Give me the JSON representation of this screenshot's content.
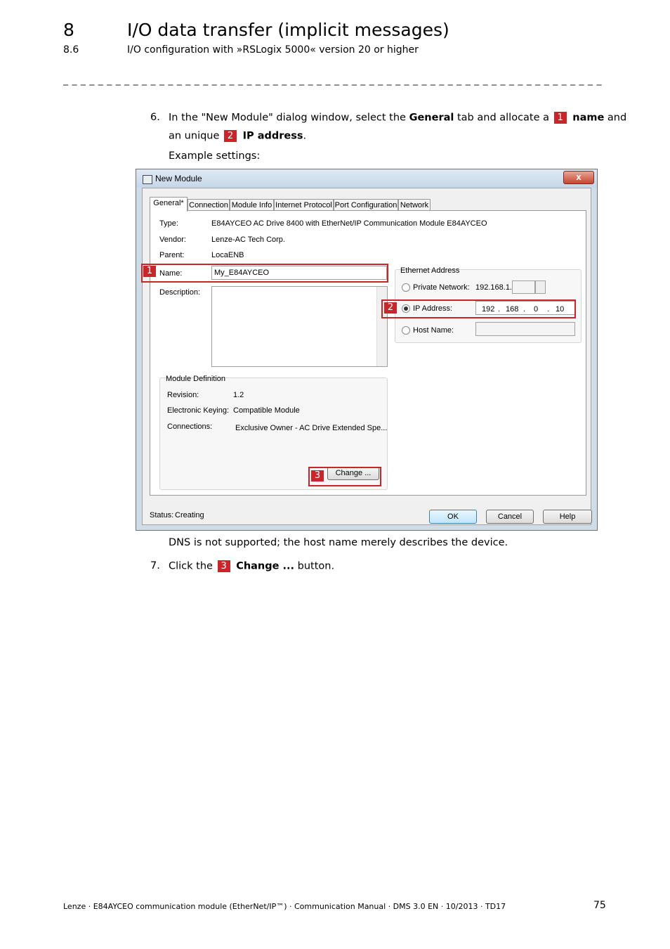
{
  "header": {
    "chapter_number": "8",
    "chapter_title": "I/O data transfer (implicit messages)",
    "section_number": "8.6",
    "section_title": "I/O configuration with »RSLogix 5000« version 20 or higher",
    "separator": "_ _ _ _ _ _ _ _ _ _ _ _ _ _ _ _ _ _ _ _ _ _ _ _ _ _ _ _ _ _ _ _ _ _ _ _ _ _ _ _ _ _ _ _ _ _ _ _ _ _ _ _ _ _ _ _ _ _ _ _ _ _ _ _ _"
  },
  "steps": {
    "step6": {
      "number": "6.",
      "line1_a": "In the \"New Module\" dialog window, select the ",
      "line1_bold": "General",
      "line1_b": " tab and allocate a ",
      "badge1": "1",
      "line1_name": "name",
      "line1_c": " and",
      "line2_a": "an unique ",
      "badge2": "2",
      "line2_bold": "IP address",
      "line2_b": ".",
      "example": "Example settings:"
    },
    "dns_note": "DNS is not supported; the host name merely describes the device.",
    "step7": {
      "number": "7.",
      "text_a": "Click the ",
      "badge3": "3",
      "text_bold": "Change ...",
      "text_b": " button."
    }
  },
  "dialog": {
    "title": "New Module",
    "close": "x",
    "tabs": [
      "General*",
      "Connection",
      "Module Info",
      "Internet Protocol",
      "Port Configuration",
      "Network"
    ],
    "type_label": "Type:",
    "type_value": "E84AYCEO AC Drive 8400 with EtherNet/IP Communication Module E84AYCEO",
    "vendor_label": "Vendor:",
    "vendor_value": "Lenze-AC Tech Corp.",
    "parent_label": "Parent:",
    "parent_value": "LocaENB",
    "name_label": "Name:",
    "name_value": "My_E84AYCEO",
    "description_label": "Description:",
    "ethernet_group": "Ethernet Address",
    "private_network_label": "Private Network:",
    "private_network_prefix": "192.168.1.",
    "ip_address_label": "IP Address:",
    "ip_octets": [
      "192",
      "168",
      "0",
      "10"
    ],
    "host_name_label": "Host Name:",
    "module_definition_group": "Module Definition",
    "revision_label": "Revision:",
    "revision_value": "1.2",
    "keying_label": "Electronic Keying:",
    "keying_value": "Compatible Module",
    "connections_label": "Connections:",
    "connections_value": "Exclusive Owner - AC Drive Extended Spe...",
    "change_button": "Change ...",
    "status_label": "Status:",
    "status_value": "Creating",
    "ok_button": "OK",
    "cancel_button": "Cancel",
    "help_button": "Help",
    "markers": [
      "1",
      "2",
      "3"
    ]
  },
  "footer": {
    "text": "Lenze · E84AYCEO communication module (EtherNet/IP™) · Communication Manual · DMS 3.0 EN · 10/2013 · TD17",
    "page": "75"
  }
}
